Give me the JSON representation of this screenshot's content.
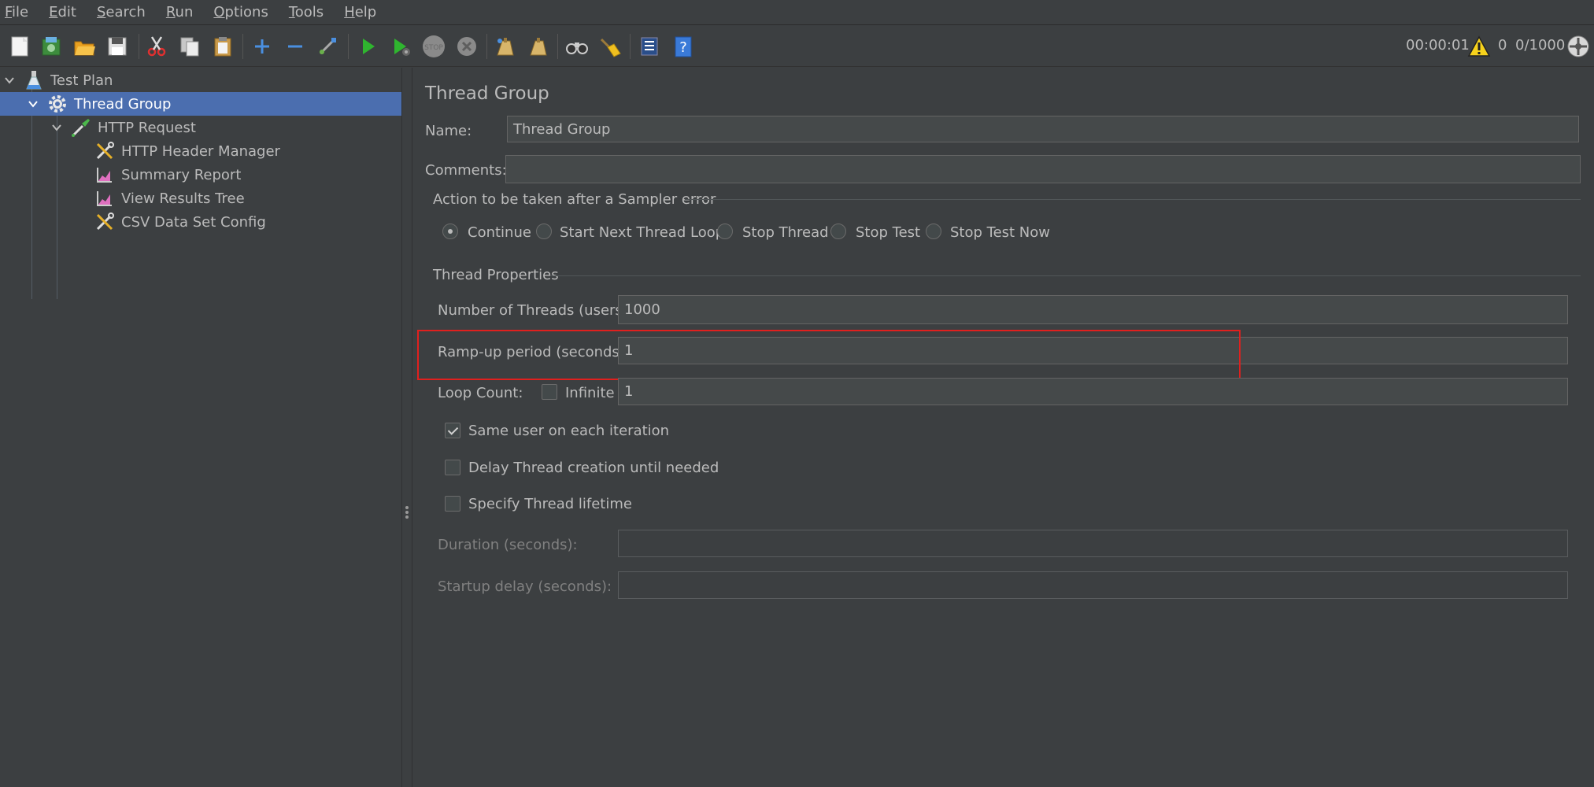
{
  "menu": [
    {
      "underline": "F",
      "rest": "ile"
    },
    {
      "underline": "E",
      "rest": "dit"
    },
    {
      "underline": "S",
      "rest": "earch"
    },
    {
      "underline": "R",
      "rest": "un"
    },
    {
      "underline": "O",
      "rest": "ptions"
    },
    {
      "underline": "T",
      "rest": "ools"
    },
    {
      "underline": "H",
      "rest": "elp"
    }
  ],
  "toolbar": {
    "elapsed": "00:00:01",
    "warning_count": "0",
    "threads": "0/1000"
  },
  "tree": {
    "items": [
      {
        "label": "Test Plan"
      },
      {
        "label": "Thread Group"
      },
      {
        "label": "HTTP Request"
      },
      {
        "label": "HTTP Header Manager"
      },
      {
        "label": "Summary Report"
      },
      {
        "label": "View Results Tree"
      },
      {
        "label": "CSV Data Set Config"
      }
    ]
  },
  "panel": {
    "title": "Thread Group",
    "name_label": "Name:",
    "name_value": "Thread Group",
    "comments_label": "Comments:",
    "comments_value": "",
    "sampler_error": {
      "legend": "Action to be taken after a Sampler error",
      "options": [
        "Continue",
        "Start Next Thread Loop",
        "Stop Thread",
        "Stop Test",
        "Stop Test Now"
      ],
      "selected": "Continue"
    },
    "thread_props": {
      "legend": "Thread Properties",
      "threads_label": "Number of Threads (users):",
      "threads_value": "1000",
      "rampup_label": "Ramp-up period (seconds):",
      "rampup_value": "1",
      "loop_label": "Loop Count:",
      "infinite_label": "Infinite",
      "infinite_checked": false,
      "loop_value": "1",
      "same_user_label": "Same user on each iteration",
      "same_user_checked": true,
      "delay_label": "Delay Thread creation until needed",
      "delay_checked": false,
      "lifetime_label": "Specify Thread lifetime",
      "lifetime_checked": false,
      "duration_label": "Duration (seconds):",
      "duration_value": "",
      "startup_label": "Startup delay (seconds):",
      "startup_value": ""
    }
  },
  "colors": {
    "background": "#3c3f41",
    "selection": "#4b6eaf",
    "highlight_box": "#e0201e"
  }
}
